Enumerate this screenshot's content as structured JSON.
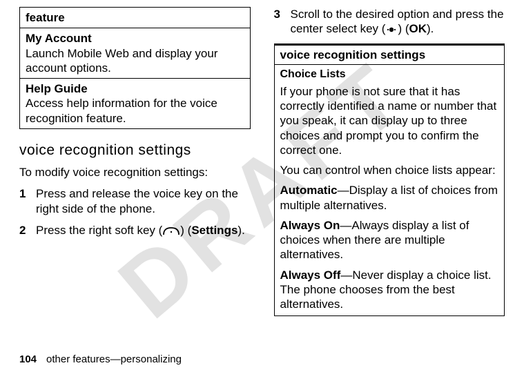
{
  "watermark": "DRAFT",
  "left": {
    "table_header": "feature",
    "row1_title": "My Account",
    "row1_desc": "Launch Mobile Web and display your account options.",
    "row2_title": "Help Guide",
    "row2_desc": "Access help information for the voice recognition feature.",
    "section_title": "voice recognition settings",
    "intro": "To modify voice recognition settings:",
    "step1_num": "1",
    "step1_body": "Press and release the voice key on the right side of the phone.",
    "step2_num": "2",
    "step2_pre": "Press the right soft key (",
    "step2_post1": ") (",
    "step2_label": "Settings",
    "step2_post2": ")."
  },
  "right": {
    "step3_num": "3",
    "step3_pre": "Scroll to the desired option and press the center select key (",
    "step3_post1": ") (",
    "step3_label": "OK",
    "step3_post2": ").",
    "box_title": "voice recognition settings",
    "sub_head": "Choice Lists",
    "p1": "If your phone is not sure that it has correctly identified a name or number that you speak, it can display up to three choices and prompt you to confirm the correct one.",
    "p2": "You can control when choice lists appear:",
    "opt1_label": "Automatic",
    "opt1_body": "—Display a list of choices from multiple alternatives.",
    "opt2_label": "Always On",
    "opt2_body": "—Always display a list of choices when there are multiple alternatives.",
    "opt3_label": "Always Off",
    "opt3_body": "—Never display a choice list. The phone chooses from the best alternatives."
  },
  "footer": {
    "page_num": "104",
    "section": "other features—personalizing"
  }
}
